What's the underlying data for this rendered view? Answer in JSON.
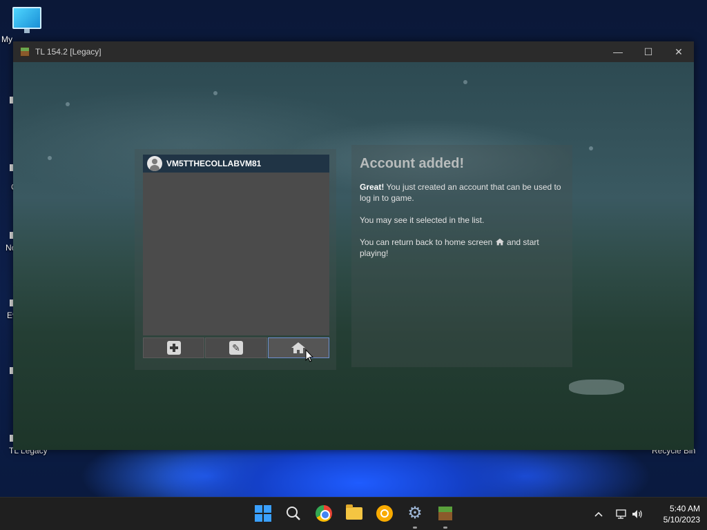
{
  "desktop": {
    "icons": {
      "my_pc_label": "My",
      "tl_legacy_label": "TL Legacy",
      "recycle_bin_label": "Recycle Bin",
      "no_label": "No",
      "ev_label": "Ev",
      "c_label": "C"
    }
  },
  "window": {
    "title": "TL 154.2 [Legacy]",
    "minimize": "—",
    "maximize": "☐",
    "close": "✕"
  },
  "accounts": {
    "items": [
      {
        "username": "VM5TTHECOLLABVM81"
      }
    ]
  },
  "toolbar": {
    "add_tooltip": "Add account",
    "edit_tooltip": "Edit account",
    "home_tooltip": "Home"
  },
  "info": {
    "heading": "Account added!",
    "para1_bold": "Great!",
    "para1_rest": " You just created an account that can be used to log in to game.",
    "para2": "You may see it selected in the list.",
    "para3_before": "You can return back to home screen ",
    "para3_after": " and start playing!"
  },
  "taskbar": {
    "time": "5:40 AM",
    "date": "5/10/2023",
    "tray_chevron": "^"
  },
  "colors": {
    "selected_row": "#203445",
    "taskbar": "#1f1f1f",
    "windows_blue": "#3aa0ff"
  }
}
